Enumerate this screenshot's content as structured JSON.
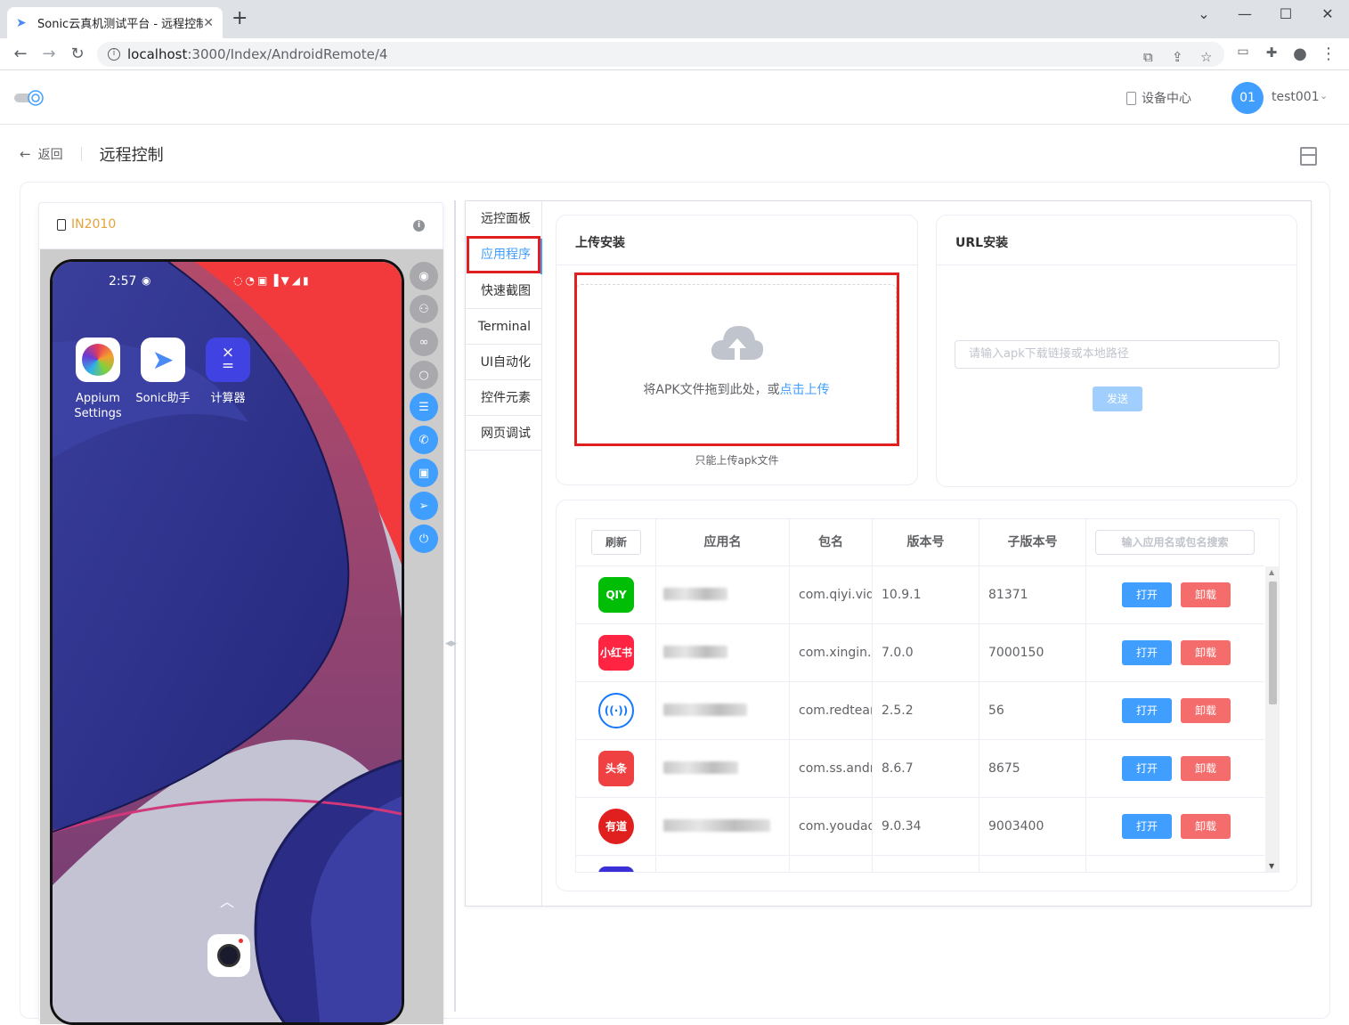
{
  "browser": {
    "tab_title": "Sonic云真机测试平台 - 远程控制",
    "url_host": "localhost",
    "url_path": ":3000/Index/AndroidRemote/4",
    "new_tab": "+",
    "win_min": "—",
    "win_max": "☐",
    "win_close": "✕",
    "icons": [
      "favicon-icon",
      "close-tab-icon",
      "back-icon",
      "forward-icon",
      "reload-icon",
      "info-icon",
      "translate-icon",
      "share-icon",
      "star-icon",
      "cast-icon",
      "extensions-icon",
      "profile-icon",
      "menu-icon"
    ]
  },
  "header": {
    "device_center": "设备中心",
    "avatar": "01",
    "username": "test001"
  },
  "page": {
    "back": "返回",
    "title": "远程控制"
  },
  "device": {
    "model": "IN2010",
    "status_time": "2:57",
    "apps": [
      {
        "name_line1": "Appium",
        "name_line2": "Settings"
      },
      {
        "name_line1": "Sonic助手",
        "name_line2": ""
      },
      {
        "name_line1": "计算器",
        "name_line2": ""
      }
    ],
    "side_buttons": [
      {
        "icon": "eye-icon",
        "color": "gray"
      },
      {
        "icon": "user-icon",
        "color": "gray"
      },
      {
        "icon": "link-icon",
        "color": "gray"
      },
      {
        "icon": "search-icon",
        "color": "gray"
      },
      {
        "icon": "settings-sliders-icon",
        "color": "blue"
      },
      {
        "icon": "phone-icon",
        "color": "blue"
      },
      {
        "icon": "camera-icon",
        "color": "blue"
      },
      {
        "icon": "location-icon",
        "color": "blue"
      },
      {
        "icon": "power-icon",
        "color": "blue"
      }
    ]
  },
  "tabs": [
    {
      "label": "远控面板",
      "active": false
    },
    {
      "label": "应用程序",
      "active": true
    },
    {
      "label": "快速截图",
      "active": false
    },
    {
      "label": "Terminal",
      "active": false
    },
    {
      "label": "UI自动化",
      "active": false
    },
    {
      "label": "控件元素",
      "active": false
    },
    {
      "label": "网页调试",
      "active": false
    }
  ],
  "upload": {
    "title": "上传安装",
    "drop_text": "将APK文件拖到此处，或",
    "drop_link": "点击上传",
    "tip": "只能上传apk文件"
  },
  "url_install": {
    "title": "URL安装",
    "placeholder": "请输入apk下载链接或本地路径",
    "send": "发送"
  },
  "table": {
    "refresh": "刷新",
    "columns": [
      "应用名",
      "包名",
      "版本号",
      "子版本号"
    ],
    "search_placeholder": "输入应用名或包名搜索",
    "open": "打开",
    "uninstall": "卸载",
    "rows": [
      {
        "icon_text": "QIY",
        "icon_color": "#00be06",
        "package": "com.qiyi.video",
        "version": "10.9.1",
        "sub_version": "81371"
      },
      {
        "icon_text": "小红书",
        "icon_color": "#ff2442",
        "package": "com.xingin.xhs",
        "version": "7.0.0",
        "sub_version": "7000150"
      },
      {
        "icon_text": "((·))",
        "icon_color": "#1677ff",
        "package": "com.redteam",
        "version": "2.5.2",
        "sub_version": "56"
      },
      {
        "icon_text": "头条",
        "icon_color": "#f04142",
        "package": "com.ss.android",
        "version": "8.6.7",
        "sub_version": "8675"
      },
      {
        "icon_text": "有道",
        "icon_color": "#e0201e",
        "package": "com.youdao.",
        "version": "9.0.34",
        "sub_version": "9003400"
      }
    ]
  },
  "colors": {
    "primary": "#409eff",
    "danger": "#f56c6c",
    "highlight_box": "#e02020",
    "model": "#e6a23c"
  }
}
